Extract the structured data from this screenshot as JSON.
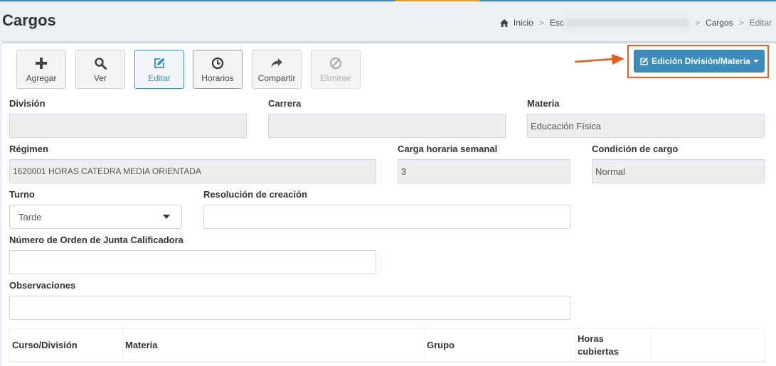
{
  "page": {
    "title": "Cargos"
  },
  "breadcrumb": {
    "home": "Inicio",
    "crumb2": "Esc",
    "crumb3": "Cargos",
    "current": "Editar"
  },
  "toolbar": {
    "add": "Agregar",
    "view": "Ver",
    "edit": "Editar",
    "schedules": "Horarios",
    "share": "Compartir",
    "delete": "Eliminar"
  },
  "edit_menu": {
    "label": "Edición División/Materia"
  },
  "form": {
    "division": {
      "label": "División",
      "value": ""
    },
    "carrera": {
      "label": "Carrera",
      "value": ""
    },
    "materia": {
      "label": "Materia",
      "value": "Educación Física"
    },
    "regimen": {
      "label": "Régimen",
      "value": "1620001 HORAS CATEDRA MEDIA ORIENTADA"
    },
    "carga": {
      "label": "Carga horaria semanal",
      "value": "3"
    },
    "condicion": {
      "label": "Condición de cargo",
      "value": "Normal"
    },
    "turno": {
      "label": "Turno",
      "value": "Tarde"
    },
    "resolucion": {
      "label": "Resolución de creación",
      "value": ""
    },
    "orden": {
      "label": "Número de Orden de Junta Calificadora",
      "value": ""
    },
    "observaciones": {
      "label": "Observaciones",
      "value": ""
    }
  },
  "table": {
    "headers": [
      "Curso/División",
      "Materia",
      "Grupo",
      "Horas cubiertas",
      ""
    ]
  },
  "colors": {
    "primary": "#3c8dbc",
    "highlight": "#f05a1a",
    "accent": "#f39c12"
  }
}
